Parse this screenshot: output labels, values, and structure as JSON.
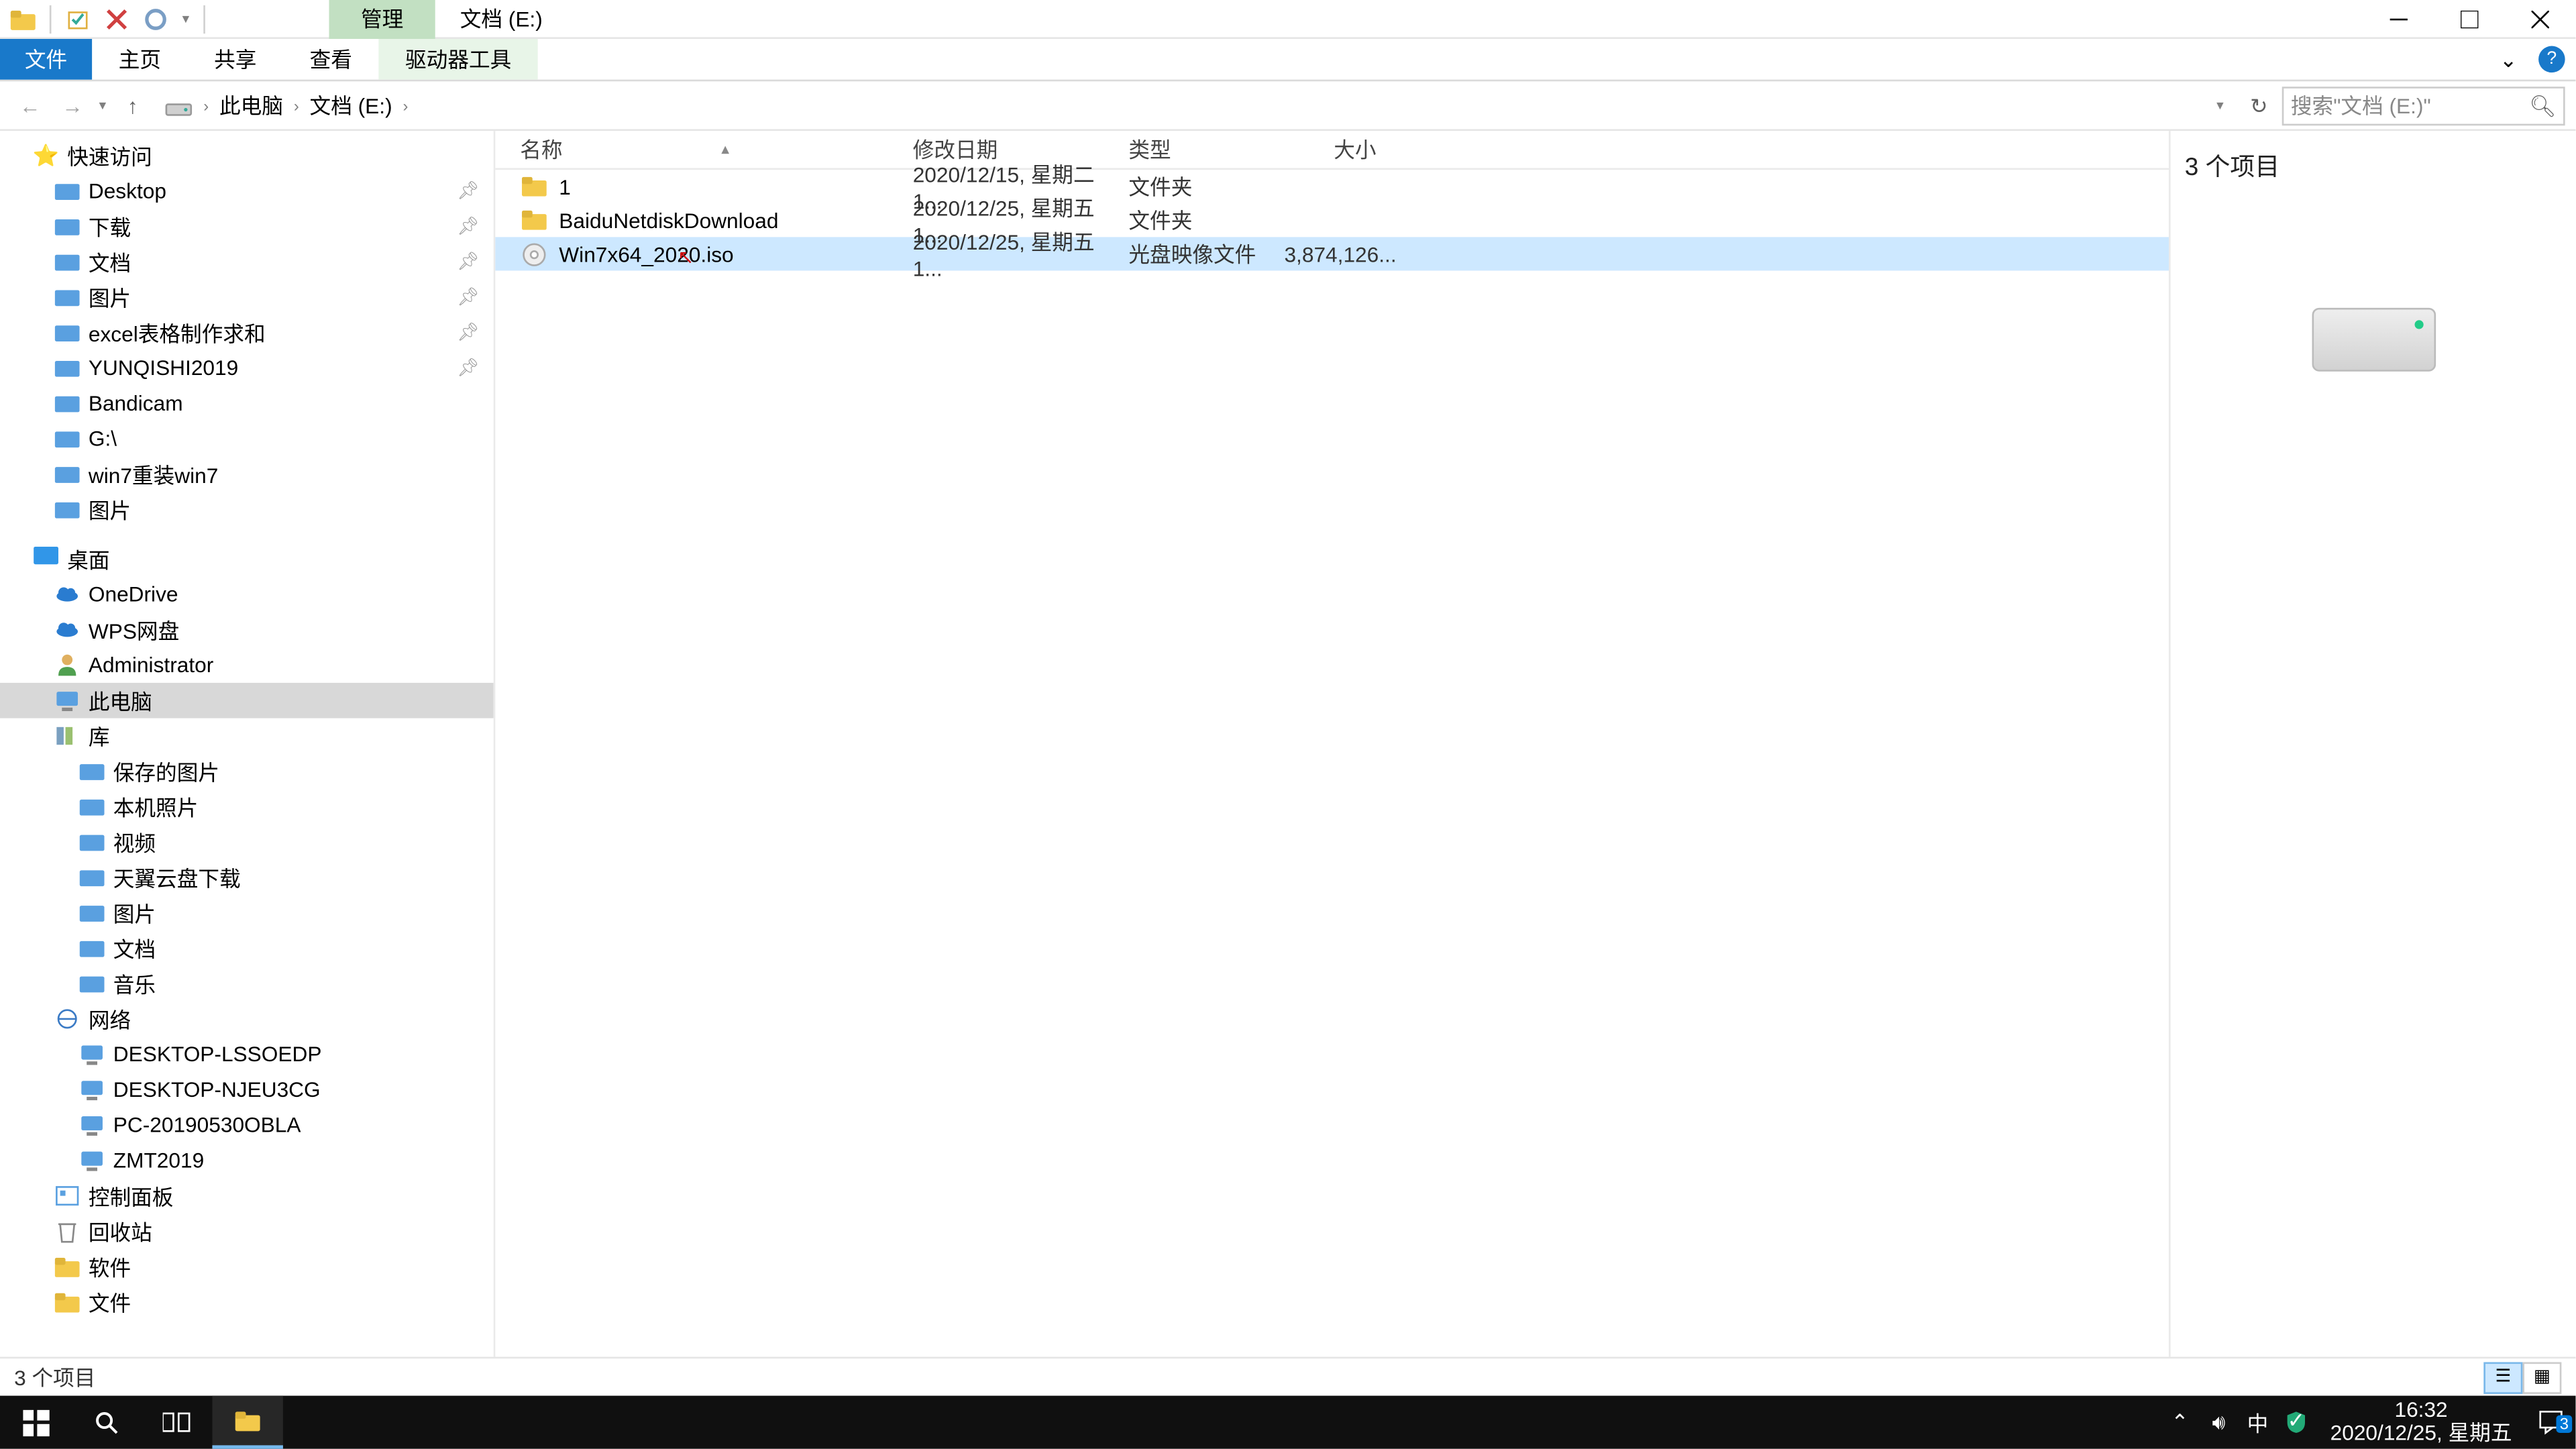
{
  "titlebar": {
    "context_tab": "管理",
    "title": "文档 (E:)"
  },
  "ribbon": {
    "file": "文件",
    "home": "主页",
    "share": "共享",
    "view": "查看",
    "drive_tools": "驱动器工具"
  },
  "address": {
    "segments": [
      "此电脑",
      "文档 (E:)"
    ],
    "search_placeholder": "搜索\"文档 (E:)\""
  },
  "nav": {
    "quick_access": "快速访问",
    "quick_items": [
      {
        "label": "Desktop",
        "pin": true
      },
      {
        "label": "下载",
        "pin": true
      },
      {
        "label": "文档",
        "pin": true
      },
      {
        "label": "图片",
        "pin": true
      },
      {
        "label": "excel表格制作求和",
        "pin": true
      },
      {
        "label": "YUNQISHI2019",
        "pin": true
      },
      {
        "label": "Bandicam",
        "pin": false
      },
      {
        "label": "G:\\",
        "pin": false
      },
      {
        "label": "win7重装win7",
        "pin": false
      },
      {
        "label": "图片",
        "pin": false
      }
    ],
    "desktop": "桌面",
    "desktop_items": [
      {
        "label": "OneDrive"
      },
      {
        "label": "WPS网盘"
      },
      {
        "label": "Administrator"
      },
      {
        "label": "此电脑",
        "selected": true
      },
      {
        "label": "库"
      }
    ],
    "library_items": [
      {
        "label": "保存的图片"
      },
      {
        "label": "本机照片"
      },
      {
        "label": "视频"
      },
      {
        "label": "天翼云盘下载"
      },
      {
        "label": "图片"
      },
      {
        "label": "文档"
      },
      {
        "label": "音乐"
      }
    ],
    "network": "网络",
    "network_items": [
      {
        "label": "DESKTOP-LSSOEDP"
      },
      {
        "label": "DESKTOP-NJEU3CG"
      },
      {
        "label": "PC-20190530OBLA"
      },
      {
        "label": "ZMT2019"
      }
    ],
    "extra": [
      {
        "label": "控制面板"
      },
      {
        "label": "回收站"
      },
      {
        "label": "软件"
      },
      {
        "label": "文件"
      }
    ]
  },
  "columns": {
    "name": "名称",
    "date": "修改日期",
    "type": "类型",
    "size": "大小"
  },
  "files": [
    {
      "name": "1",
      "date": "2020/12/15, 星期二 1...",
      "type": "文件夹",
      "size": "",
      "kind": "folder"
    },
    {
      "name": "BaiduNetdiskDownload",
      "date": "2020/12/25, 星期五 1...",
      "type": "文件夹",
      "size": "",
      "kind": "folder"
    },
    {
      "name": "Win7x64_2020.iso",
      "date": "2020/12/25, 星期五 1...",
      "type": "光盘映像文件",
      "size": "3,874,126...",
      "kind": "iso",
      "selected": true
    }
  ],
  "details": {
    "header": "3 个项目"
  },
  "status": {
    "text": "3 个项目"
  },
  "clock": {
    "time": "16:32",
    "date": "2020/12/25, 星期五"
  },
  "tray": {
    "ime": "中",
    "notif_count": "3"
  }
}
